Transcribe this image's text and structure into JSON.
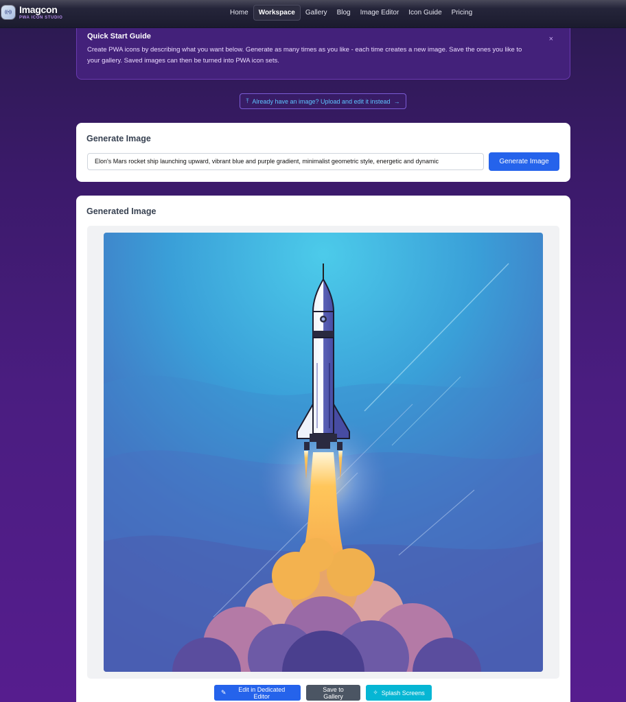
{
  "brand": {
    "name": "Imagcon",
    "subtitle": "PWA ICON STUDIO",
    "logo_text": "((•))"
  },
  "nav": {
    "items": [
      {
        "label": "Home",
        "active": false
      },
      {
        "label": "Workspace",
        "active": true
      },
      {
        "label": "Gallery",
        "active": false
      },
      {
        "label": "Blog",
        "active": false
      },
      {
        "label": "Image Editor",
        "active": false
      },
      {
        "label": "Icon Guide",
        "active": false
      },
      {
        "label": "Pricing",
        "active": false
      }
    ]
  },
  "quick_start": {
    "title": "Quick Start Guide",
    "body": "Create PWA icons by describing what you want below. Generate as many times as you like - each time creates a new image. Save the ones you like to your gallery. Saved images can then be turned into PWA icon sets.",
    "close": "×"
  },
  "upload_link": {
    "icon": "⤒",
    "label": "Already have an image? Upload and edit it instead",
    "arrow": "→"
  },
  "generate": {
    "title": "Generate Image",
    "prompt_value": "Elon's Mars rocket ship launching upward, vibrant blue and purple gradient, minimalist geometric style, energetic and dynamic",
    "button": "Generate Image"
  },
  "generated": {
    "title": "Generated Image",
    "image_alt": "rocket-launch-illustration"
  },
  "actions": {
    "edit": {
      "icon": "✎",
      "label": "Edit in Dedicated Editor"
    },
    "save": {
      "label": "Save to Gallery"
    },
    "splash": {
      "icon": "✧",
      "label": "Splash Screens"
    }
  },
  "colors": {
    "primary": "#2563eb",
    "secondary": "#4b5563",
    "accent": "#06b6d4",
    "link": "#5ec4ff"
  }
}
